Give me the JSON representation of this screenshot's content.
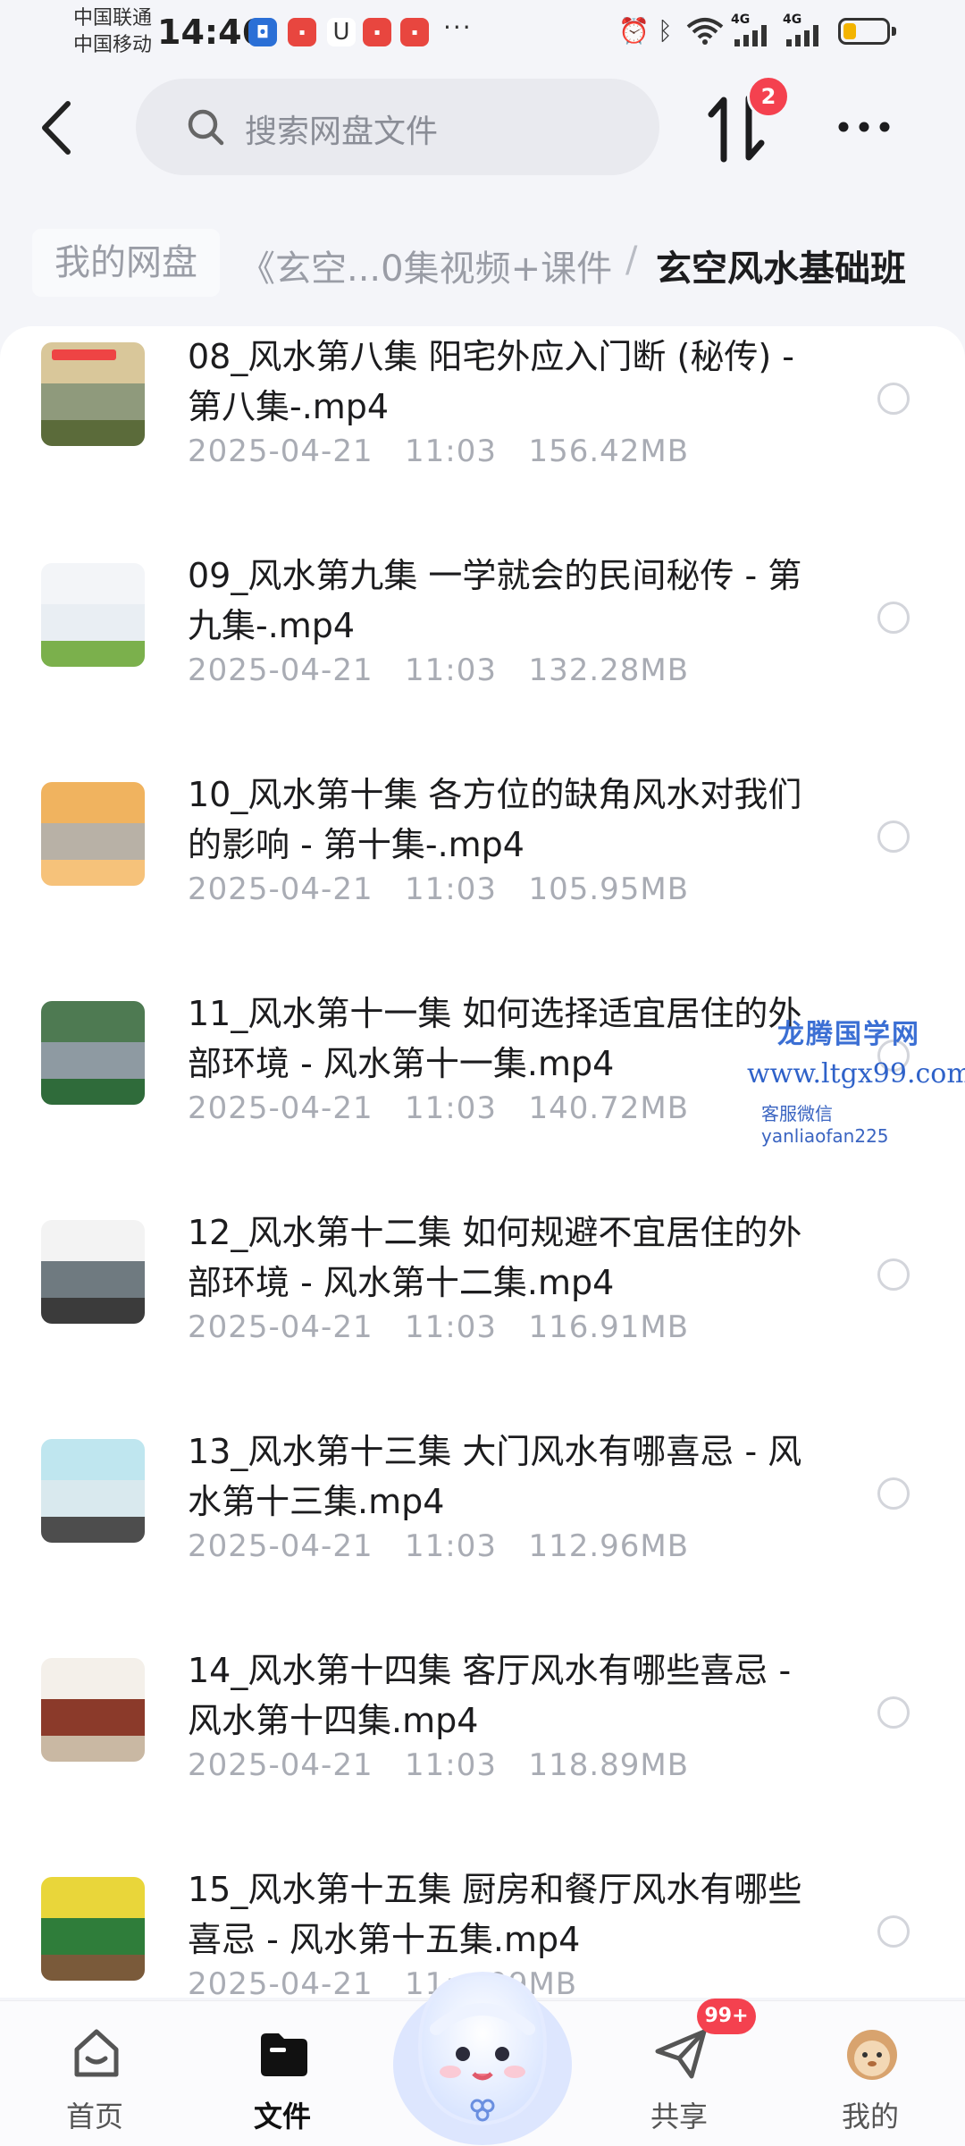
{
  "status_bar": {
    "carrier_1": "中国联通",
    "carrier_2": "中国移动",
    "time": "14:46",
    "app_icons": [
      "notification-app-icon",
      "huawei-app-icon",
      "notification-app-icon",
      "huawei-app-icon",
      "huawei-app-icon"
    ],
    "more_symbol": "···",
    "network_1": "4G",
    "network_2": "4G",
    "battery_level": 0.3
  },
  "header": {
    "search_placeholder": "搜索网盘文件",
    "transfer_badge": "2"
  },
  "breadcrumb": {
    "root": "我的网盘",
    "middle": "《玄空...0集视频+课件",
    "separator": "/",
    "current": "玄空风水基础班"
  },
  "files": [
    {
      "name": "08_风水第八集 阳宅外应入门断 (秘传) - 第八集-.mp4",
      "date": "2025-04-21",
      "time": "11:03",
      "size": "156.42MB",
      "thumb_colors": [
        "#d9c79a",
        "#8f9a7c",
        "#5b6b3a"
      ]
    },
    {
      "name": "09_风水第九集 一学就会的民间秘传 - 第九集-.mp4",
      "date": "2025-04-21",
      "time": "11:03",
      "size": "132.28MB",
      "thumb_colors": [
        "#f3f5f8",
        "#e9eef3",
        "#7bb04c"
      ]
    },
    {
      "name": "10_风水第十集 各方位的缺角风水对我们的影响 - 第十集-.mp4",
      "date": "2025-04-21",
      "time": "11:03",
      "size": "105.95MB",
      "thumb_colors": [
        "#f0b35f",
        "#b8b1a6",
        "#f6c27a"
      ]
    },
    {
      "name": "11_风水第十一集 如何选择适宜居住的外部环境 - 风水第十一集.mp4",
      "date": "2025-04-21",
      "time": "11:03",
      "size": "140.72MB",
      "thumb_colors": [
        "#4e7a52",
        "#8e9aa2",
        "#2f6b3a"
      ]
    },
    {
      "name": "12_风水第十二集 如何规避不宜居住的外部环境 - 风水第十二集.mp4",
      "date": "2025-04-21",
      "time": "11:03",
      "size": "116.91MB",
      "thumb_colors": [
        "#f3f3f3",
        "#6f7a80",
        "#3b3b3b"
      ]
    },
    {
      "name": "13_风水第十三集 大门风水有哪喜忌 - 风水第十三集.mp4",
      "date": "2025-04-21",
      "time": "11:03",
      "size": "112.96MB",
      "thumb_colors": [
        "#bfe6ef",
        "#d9e9ee",
        "#4d4d4d"
      ]
    },
    {
      "name": "14_风水第十四集 客厅风水有哪些喜忌 - 风水第十四集.mp4",
      "date": "2025-04-21",
      "time": "11:03",
      "size": "118.89MB",
      "thumb_colors": [
        "#f4f0ea",
        "#8b3a2a",
        "#c9b8a3"
      ]
    },
    {
      "name": "15_风水第十五集 厨房和餐厅风水有哪些喜忌 - 风水第十五集.mp4",
      "date": "2025-04-21",
      "time": "11:",
      "size": "09MB",
      "thumb_colors": [
        "#e9d63a",
        "#2f7d3a",
        "#7a5a3a"
      ]
    }
  ],
  "watermark": {
    "line1": "龙腾国学网",
    "line2": "www.ltgx99.com",
    "line3": "客服微信 yanliaofan225"
  },
  "bottom_nav": {
    "home": "首页",
    "files": "文件",
    "share": "共享",
    "share_badge": "99+",
    "mine": "我的"
  },
  "colors": {
    "accent_red": "#f4414f",
    "background": "#f4f5f9",
    "list_bg": "#ffffff"
  }
}
